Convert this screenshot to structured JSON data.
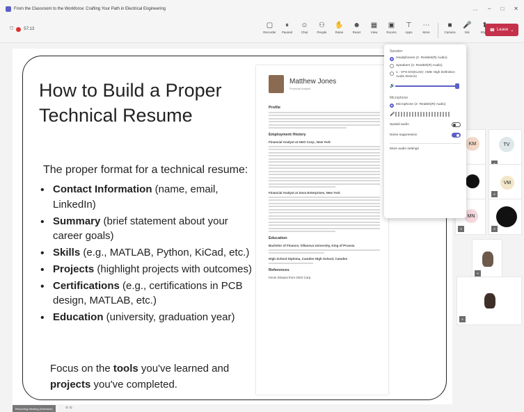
{
  "window": {
    "title": "From the Classroom to the Workforce: Crafting Your Path in Electrical Engineering",
    "controls": [
      "…",
      "–",
      "□",
      "✕"
    ]
  },
  "toolbar": {
    "timer": "57:13",
    "tools": [
      {
        "icon": "recorder-icon",
        "glyph": "▢",
        "label": "Recorder"
      },
      {
        "icon": "pause-icon",
        "glyph": "⏸",
        "label": "Paused"
      },
      {
        "icon": "chat-icon",
        "glyph": "☺",
        "label": "Chat"
      },
      {
        "icon": "people-icon",
        "glyph": "⚇",
        "label": "People"
      },
      {
        "icon": "raise-hand-icon",
        "glyph": "✋",
        "label": "Raise"
      },
      {
        "icon": "react-icon",
        "glyph": "☻",
        "label": "React"
      },
      {
        "icon": "view-icon",
        "glyph": "▦",
        "label": "View"
      },
      {
        "icon": "rooms-icon",
        "glyph": "▣",
        "label": "Rooms"
      },
      {
        "icon": "apps-icon",
        "glyph": "⊤",
        "label": "Apps"
      },
      {
        "icon": "more-icon",
        "glyph": "⋯",
        "label": "More"
      },
      {
        "icon": "camera-icon",
        "glyph": "■",
        "label": "Camera"
      },
      {
        "icon": "mic-icon",
        "glyph": "🎤",
        "label": "Mic"
      },
      {
        "icon": "share-icon",
        "glyph": "⬆",
        "label": "Share"
      }
    ],
    "leave_label": "Leave"
  },
  "slide": {
    "title": "How to Build a Proper Technical Resume",
    "intro": "The proper format for a technical resume:",
    "bullets": [
      {
        "bold": "Contact Information",
        "rest": " (name, email, LinkedIn)"
      },
      {
        "bold": "Summary",
        "rest": " (brief statement about your career goals)"
      },
      {
        "bold": "Skills",
        "rest": " (e.g., MATLAB, Python, KiCad, etc.)"
      },
      {
        "bold": "Projects",
        "rest": " (highlight projects with outcomes)"
      },
      {
        "bold": "Certifications",
        "rest": " (e.g., certifications in PCB design, MATLAB, etc.)"
      },
      {
        "bold": "Education",
        "rest": " (university, graduation year)"
      }
    ],
    "focus": {
      "a": "Focus on the ",
      "b": "tools",
      "c": " you've learned and ",
      "d": "projects",
      "e": " you've completed."
    }
  },
  "resume": {
    "name": "Matthew Jones",
    "role": "Financial Analyst",
    "profile_h": "Profile",
    "employment_h": "Employment History",
    "job1": "Financial Analyst at GEO Corp., New York",
    "job2": "Financial Analyst at Sova Enterprises, New York",
    "education_h": "Education",
    "edu1": "Bachelor of Finance, Villanova University, King of Prussia",
    "edu2": "High School Diploma, Camden High School, Camden",
    "references_h": "References",
    "ref1": "Kevin Strauss from GEO Corp."
  },
  "audio_popup": {
    "speaker_label": "Speaker",
    "speaker_options": [
      {
        "label": "Headphones (2- Realtek(R) Audio)",
        "selected": true
      },
      {
        "label": "Speakers (2- Realtek(R) Audio)",
        "selected": false
      },
      {
        "label": "1 - VFS-DX(KL02)- AMD High Definition Audio Device)",
        "selected": false
      }
    ],
    "speaker_volume": 1.0,
    "mic_label": "Microphone",
    "mic_options": [
      {
        "label": "Microphone (2- Realtek(R) Audio)",
        "selected": true
      }
    ],
    "spatial_label": "Spatial audio",
    "spatial_on": false,
    "noise_label": "Noise suppression",
    "noise_on": true,
    "more_label": "More audio settings"
  },
  "participants": [
    {
      "initials": "KM",
      "color": "#f3d9c8"
    },
    {
      "initials": "TV",
      "color": "#dfe7ea"
    },
    {
      "initials": "",
      "color": "#111111"
    },
    {
      "initials": "VM",
      "color": "#f2e6c8"
    },
    {
      "initials": "MN",
      "color": "#f4d7dc"
    },
    {
      "initials": "",
      "color": "#111111"
    }
  ],
  "bottom": {
    "chip": "Recording Meeting (Selective)",
    "extra": "⊙ ⊙"
  },
  "colors": {
    "accent": "#5b5fc7",
    "leave": "#c4314b"
  }
}
